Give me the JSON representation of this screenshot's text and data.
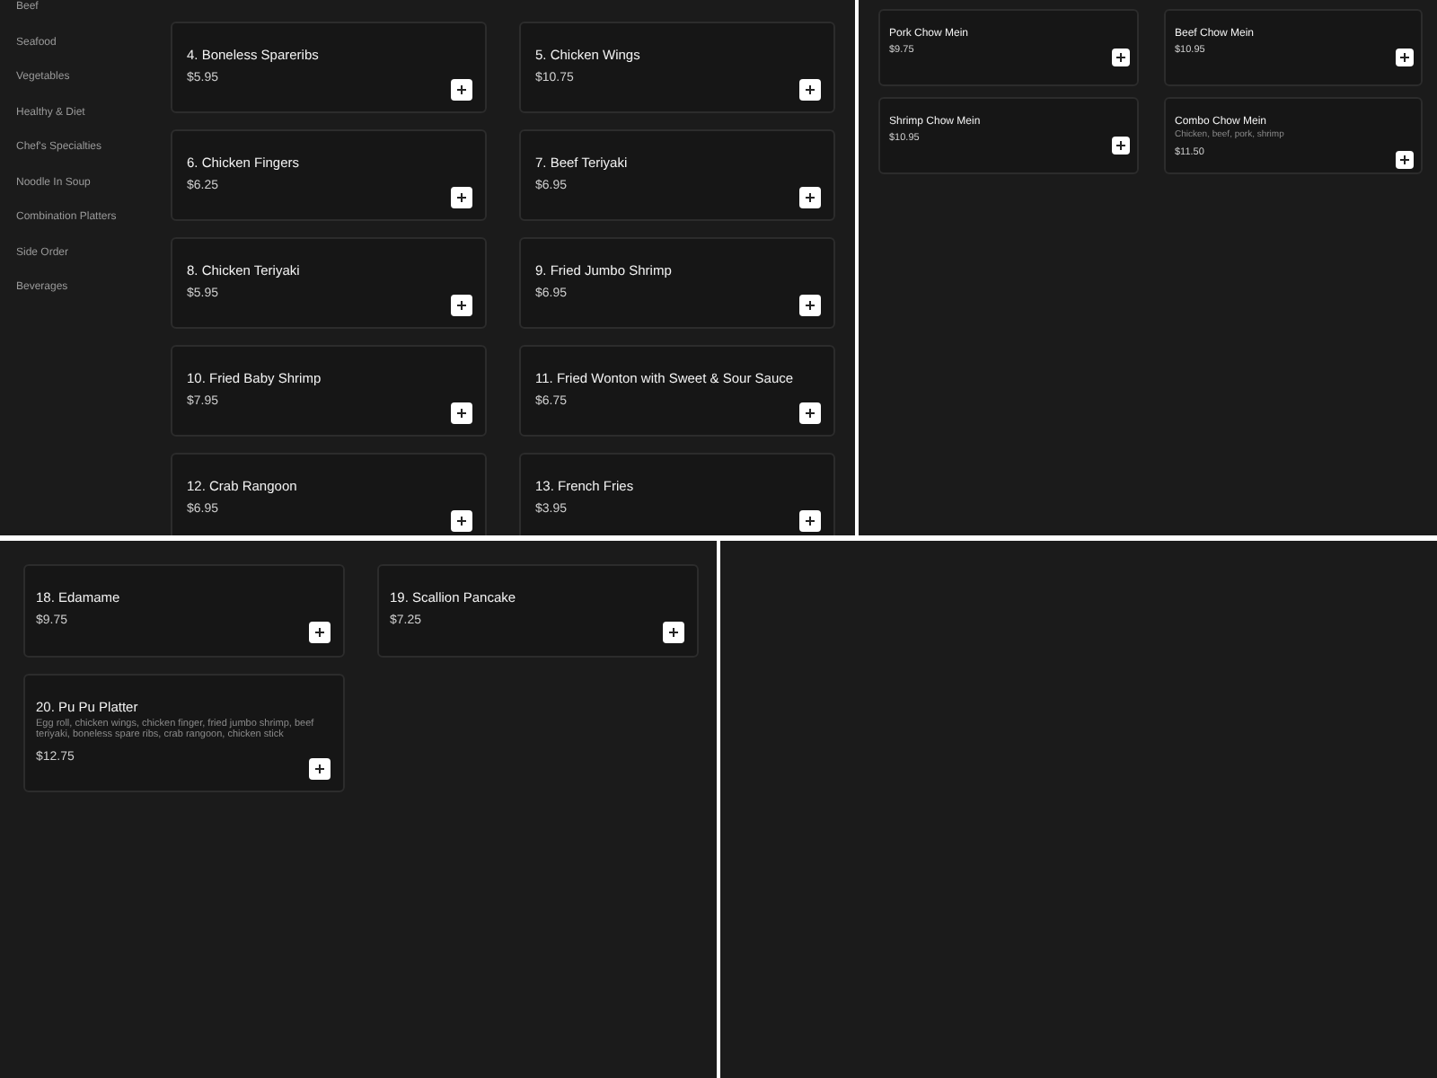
{
  "panels": [
    {
      "kind": "wide",
      "sidebar": {
        "items": [
          "Beef",
          "Seafood",
          "Vegetables",
          "Healthy & Diet",
          "Chef's Specialties",
          "Noodle In Soup",
          "Combination Platters",
          "Side Order",
          "Beverages"
        ]
      },
      "cards": [
        {
          "name": "4. Boneless Spareribs",
          "price": "$5.95"
        },
        {
          "name": "5. Chicken Wings",
          "price": "$10.75"
        },
        {
          "name": "6. Chicken Fingers",
          "price": "$6.25"
        },
        {
          "name": "7. Beef Teriyaki",
          "price": "$6.95"
        },
        {
          "name": "8. Chicken Teriyaki",
          "price": "$5.95"
        },
        {
          "name": "9. Fried Jumbo Shrimp",
          "price": "$6.95"
        },
        {
          "name": "10. Fried Baby Shrimp",
          "price": "$7.95"
        },
        {
          "name": "11. Fried Wonton with Sweet & Sour Sauce",
          "price": "$6.75"
        },
        {
          "name": "12. Crab Rangoon",
          "price": "$6.95"
        },
        {
          "name": "13. French Fries",
          "price": "$3.95"
        }
      ]
    },
    {
      "kind": "compact",
      "cards": [
        {
          "name": "Pork Chow Mein",
          "price": "$9.75"
        },
        {
          "name": "Beef Chow Mein",
          "price": "$10.95"
        },
        {
          "name": "Shrimp Chow Mein",
          "price": "$10.95"
        },
        {
          "name": "Combo Chow Mein",
          "description": "Chicken, beef, pork, shrimp",
          "price": "$11.50"
        }
      ]
    },
    {
      "kind": "plain",
      "cards": [
        {
          "name": "18. Edamame",
          "price": "$9.75"
        },
        {
          "name": "19. Scallion Pancake",
          "price": "$7.25"
        },
        {
          "name": "20. Pu Pu Platter",
          "description": "Egg roll, chicken wings, chicken finger, fried jumbo shrimp, beef teriyaki, boneless spare ribs, crab rangoon, chicken stick",
          "price": "$12.75"
        }
      ]
    },
    {
      "kind": "blank"
    }
  ]
}
